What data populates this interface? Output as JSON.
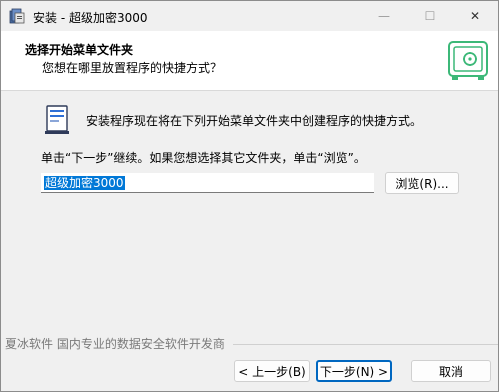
{
  "window": {
    "title": "安装 - 超级加密3000",
    "minimize": "—",
    "maximize": "☐",
    "close": "✕"
  },
  "header": {
    "title": "选择开始菜单文件夹",
    "subtitle": "您想在哪里放置程序的快捷方式？"
  },
  "body": {
    "intro": "安装程序现在将在下列开始菜单文件夹中创建程序的快捷方式。",
    "hint": "单击“下一步”继续。如果您想选择其它文件夹，单击“浏览”。",
    "folder_value": "超级加密3000",
    "browse_label": "浏览(R)..."
  },
  "footer": {
    "brand": "夏冰软件 国内专业的数据安全软件开发商",
    "back_label": "< 上一步(B)",
    "next_label": "下一步(N) >",
    "cancel_label": "取消"
  },
  "colors": {
    "accent": "#0067c0",
    "selection": "#0078d7",
    "safe_green": "#3cb878"
  }
}
